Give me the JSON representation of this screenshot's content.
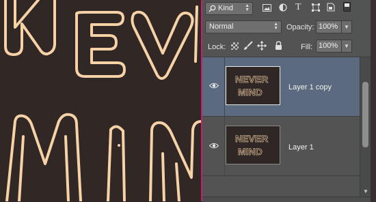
{
  "filter": {
    "kind_label": "Kind"
  },
  "blend": {
    "mode": "Normal",
    "opacity_label": "Opacity:",
    "opacity_value": "100%"
  },
  "lock": {
    "lock_label": "Lock:",
    "fill_label": "Fill:",
    "fill_value": "100%"
  },
  "layers": [
    {
      "name": "Layer 1 copy",
      "selected": true
    },
    {
      "name": "Layer 1",
      "selected": false
    }
  ],
  "thumbnail_text": {
    "line1": "NEVER",
    "line2": "MIND"
  },
  "colors": {
    "canvas_bg": "#312826",
    "letter_color": "#f7d2a7",
    "panel_bg": "#535353",
    "selection": "#5b6a7e",
    "divider": "#c0246e"
  },
  "icons": [
    "search-icon",
    "image-filter-icon",
    "adjustment-filter-icon",
    "type-filter-icon",
    "shape-filter-icon",
    "smart-object-filter-icon",
    "filter-toggle",
    "lock-transparent-icon",
    "lock-brush-icon",
    "lock-move-icon",
    "lock-all-icon",
    "eye-icon"
  ]
}
